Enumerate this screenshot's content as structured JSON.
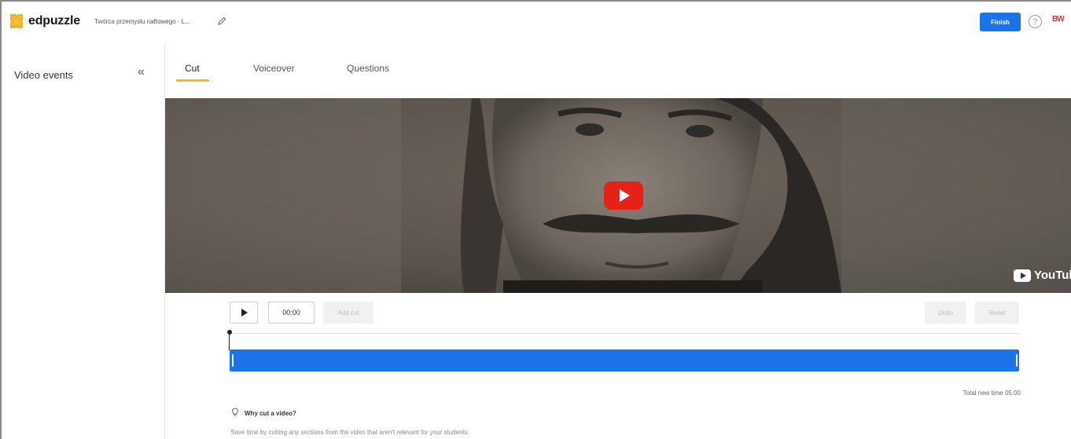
{
  "header": {
    "logo_text": "edpuzzle",
    "doc_title": "Twórca przemysłu naftowego - L...",
    "finish_label": "Finish",
    "help_symbol": "?",
    "avatar_text": "BW",
    "accent_color": "#1a73e8"
  },
  "sidebar": {
    "title": "Video events",
    "collapse_symbol": "«"
  },
  "tabs": [
    {
      "label": "Cut",
      "active": true
    },
    {
      "label": "Voiceover",
      "active": false
    },
    {
      "label": "Questions",
      "active": false
    }
  ],
  "video": {
    "play_button": "youtube-play",
    "watermark": "YouTube"
  },
  "controls": {
    "time_value": "00:00",
    "add_cut_label": "Add cut",
    "undo_label": "Undo",
    "reset_label": "Reset"
  },
  "timeline": {
    "color": "#1a73e8"
  },
  "summary": {
    "total_time": "Total new time 05:00"
  },
  "tip": {
    "title": "Why cut a video?",
    "text": "Save time by cutting any sections from the video that aren't relevant for your students."
  }
}
